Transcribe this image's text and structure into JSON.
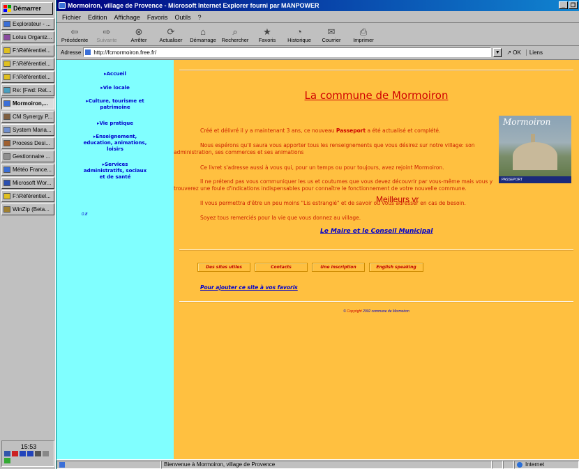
{
  "taskbar": {
    "start_label": "Démarrer",
    "items": [
      {
        "label": "Explorateur - ...",
        "active": false
      },
      {
        "label": "Lotus Organiz...",
        "active": false
      },
      {
        "label": "F:\\Référentiel...",
        "active": false
      },
      {
        "label": "F:\\Référentiel...",
        "active": false
      },
      {
        "label": "F:\\Référentiel...",
        "active": false
      },
      {
        "label": "Re: [Fwd: Ret...",
        "active": false
      },
      {
        "label": "Mormoiron,...",
        "active": true
      },
      {
        "label": "CM Synergy P...",
        "active": false
      },
      {
        "label": "System Mana...",
        "active": false
      },
      {
        "label": "Process Desi...",
        "active": false
      },
      {
        "label": "Gestionnaire ...",
        "active": false
      },
      {
        "label": "Météo France...",
        "active": false
      },
      {
        "label": "Microsoft Wor...",
        "active": false
      },
      {
        "label": "F:\\Référentiel...",
        "active": false
      },
      {
        "label": "WinZip (Beta...",
        "active": false
      }
    ],
    "clock": "15:53"
  },
  "browser": {
    "title": "Mormoiron, village de Provence - Microsoft Internet Explorer fourni par MANPOWER",
    "menu": [
      "Fichier",
      "Edition",
      "Affichage",
      "Favoris",
      "Outils",
      "?"
    ],
    "toolbar": [
      {
        "label": "Précédente",
        "icon": "back-arrow-icon",
        "glyph": "⇦",
        "disabled": false
      },
      {
        "label": "Suivante",
        "icon": "forward-arrow-icon",
        "glyph": "⇨",
        "disabled": true
      },
      {
        "label": "Arrêter",
        "icon": "stop-icon",
        "glyph": "⊗",
        "disabled": false
      },
      {
        "label": "Actualiser",
        "icon": "refresh-icon",
        "glyph": "⟳",
        "disabled": false
      },
      {
        "label": "Démarrage",
        "icon": "home-icon",
        "glyph": "⌂",
        "disabled": false
      },
      {
        "label": "Rechercher",
        "icon": "search-icon",
        "glyph": "⌕",
        "disabled": false
      },
      {
        "label": "Favoris",
        "icon": "favorites-icon",
        "glyph": "★",
        "disabled": false
      },
      {
        "label": "Historique",
        "icon": "history-icon",
        "glyph": "◔",
        "disabled": false
      },
      {
        "label": "Courrier",
        "icon": "mail-icon",
        "glyph": "✉",
        "disabled": false
      },
      {
        "label": "Imprimer",
        "icon": "print-icon",
        "glyph": "⎙",
        "disabled": false
      }
    ],
    "address_label": "Adresse",
    "address_value": "http://fcmormoiron.free.fr/",
    "go_label": "OK",
    "links_label": "Liens",
    "status_text": "Bienvenue à Mormoiron, village de Provence",
    "zone_label": "Internet"
  },
  "page": {
    "nav": [
      "Accueil",
      "Vie locale",
      "Culture, tourisme et patrimoine",
      "Vie pratique",
      "Enseignement, education, animations, loisirs",
      "Services administratifs, sociaux et de santé"
    ],
    "nav_version": "0.8",
    "heading": "La commune de Mormoiron",
    "paragraphs": {
      "p1_before": "Créé et délivré il y a maintenant 3 ans, ce nouveau ",
      "p1_bold": "Passeport",
      "p1_after": " a été actualisé et complété.",
      "p2": "Nous espérons qu'il saura vous apporter tous les renseignements que vous désirez sur notre village: son administration, ses commerces et ses animations",
      "p3": "Ce livret s'adresse aussi à vous qui, pour un temps ou pour toujours, avez rejoint Mormoiron.",
      "p4": "Il ne prétend pas vous communiquer les us et coutumes que vous devez découvrir par vous-même mais vous y trouverez une foule d'indications indispensables pour connaître le fonctionnement de votre nouvelle commune.",
      "p5": "Il vous permettra d'être un peu moins \"Lis estrangié\" et de savoir où vous adresser en cas de besoin.",
      "p6": "Soyez tous remerciés pour la vie que vous donnez au village."
    },
    "overlay_text": "Meilleurs vr",
    "image_title": "Mormoiron",
    "image_footer": "PASSEPORT",
    "signature": "Le Maire et le Conseil Municipal",
    "buttons": [
      "Des sites utiles",
      "Contacts",
      "Une inscription",
      "English speaking"
    ],
    "favorites_link": "Pour ajouter ce site à vos favoris",
    "copyright_link": "Copyright",
    "copyright_rest": " 2002 commune de Mormoiron"
  }
}
